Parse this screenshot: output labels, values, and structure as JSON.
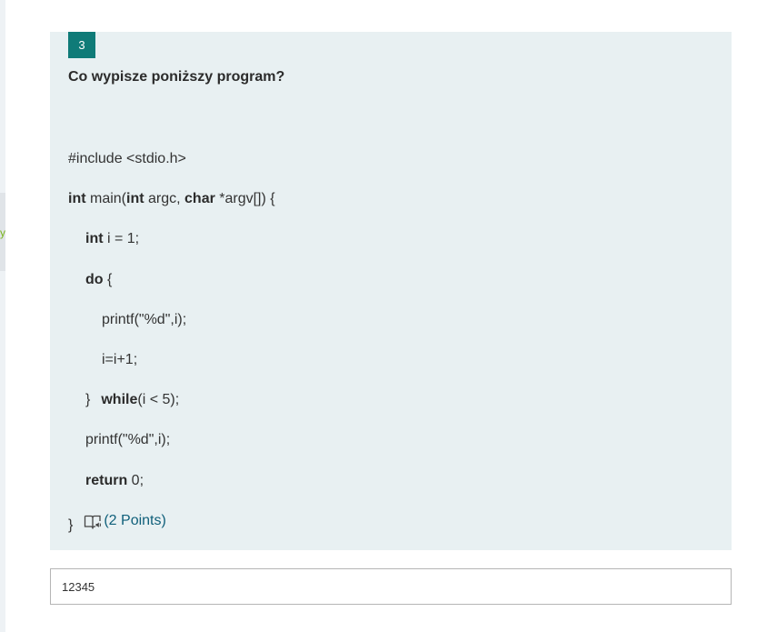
{
  "sidebar": {
    "partial_glyph": "y"
  },
  "question": {
    "number": "3",
    "title": "Co wypisze poniższy program?",
    "code": {
      "line1": "#include <stdio.h>",
      "line2": {
        "kw_int": "int",
        "t1": " main(",
        "kw_int2": "int",
        "t2": " argc, ",
        "kw_char": "char",
        "t3": " *argv[]) {"
      },
      "line3": {
        "kw": "int",
        "rest": " i = 1;"
      },
      "line4": {
        "kw": "do",
        "rest": " {"
      },
      "line5": "printf(\"%d\",i);",
      "line6": "i=i+1;",
      "line7": {
        "brace": "}",
        "kw": "while",
        "rest": "(i < 5);"
      },
      "line8": "printf(\"%d\",i);",
      "line9": {
        "kw": "return",
        "rest": " 0;"
      },
      "line10": "}"
    },
    "points": "(2 Points)",
    "immersive_reader_icon": "immersive-reader-icon"
  },
  "answer": {
    "value": "12345"
  },
  "colors": {
    "accent": "#0f7b78",
    "card_background": "#e8f0f2",
    "points_text": "#0f5f7a"
  }
}
